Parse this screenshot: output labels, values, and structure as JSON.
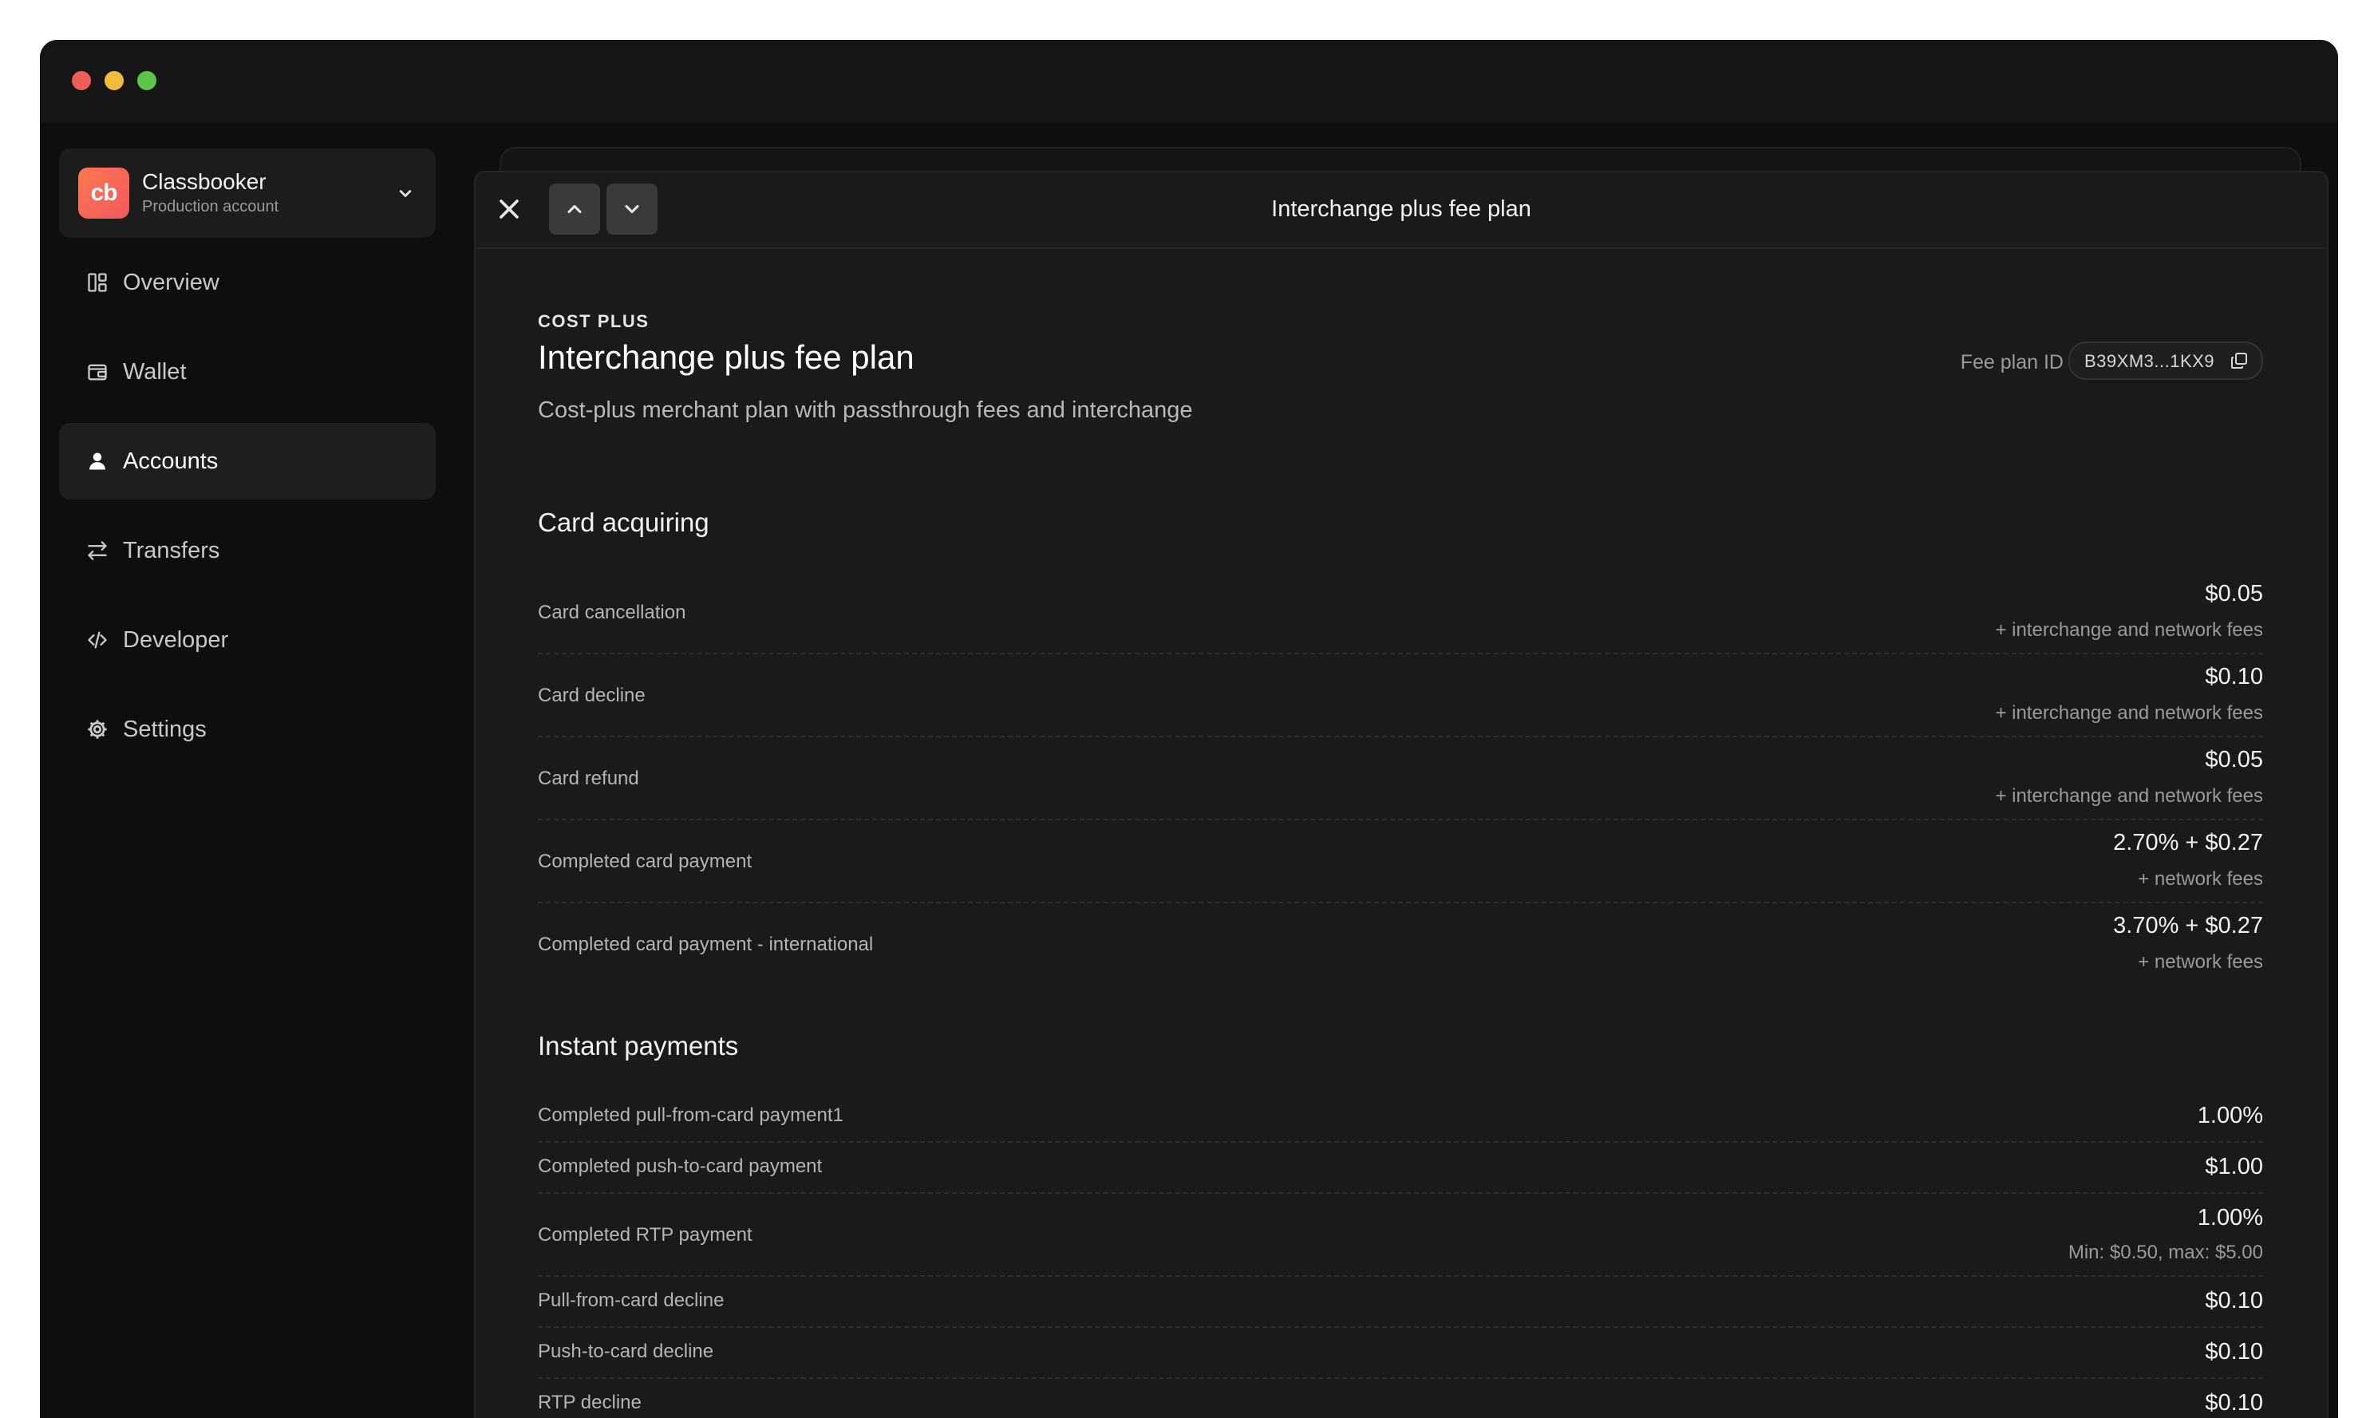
{
  "account": {
    "name": "Classbooker",
    "subtitle": "Production account",
    "logo_text": "cb"
  },
  "sidebar": {
    "items": [
      {
        "label": "Overview",
        "icon": "layout-grid-icon"
      },
      {
        "label": "Wallet",
        "icon": "wallet-icon"
      },
      {
        "label": "Accounts",
        "icon": "user-icon",
        "active": true
      },
      {
        "label": "Transfers",
        "icon": "transfer-arrows-icon"
      },
      {
        "label": "Developer",
        "icon": "code-icon"
      },
      {
        "label": "Settings",
        "icon": "gear-icon"
      }
    ]
  },
  "panel": {
    "header_title": "Interchange plus fee plan",
    "eyebrow": "COST PLUS",
    "title": "Interchange plus fee plan",
    "description": "Cost-plus merchant plan with passthrough fees and interchange",
    "fee_plan_id_label": "Fee plan ID",
    "fee_plan_id": "B39XM3...1KX9"
  },
  "sections": [
    {
      "title": "Card acquiring",
      "rows": [
        {
          "label": "Card cancellation",
          "value": "$0.05",
          "note": "+ interchange and network fees"
        },
        {
          "label": "Card decline",
          "value": "$0.10",
          "note": "+ interchange and network fees"
        },
        {
          "label": "Card refund",
          "value": "$0.05",
          "note": "+ interchange and network fees"
        },
        {
          "label": "Completed card payment",
          "value": "2.70% + $0.27",
          "note": "+ network fees"
        },
        {
          "label": "Completed card payment - international",
          "value": "3.70% + $0.27",
          "note": "+ network fees"
        }
      ]
    },
    {
      "title": "Instant payments",
      "rows": [
        {
          "label": "Completed pull-from-card payment1",
          "value": "1.00%"
        },
        {
          "label": "Completed push-to-card payment",
          "value": "$1.00"
        },
        {
          "label": "Completed RTP payment",
          "value": "1.00%",
          "note": "Min: $0.50, max: $5.00"
        },
        {
          "label": "Pull-from-card decline",
          "value": "$0.10"
        },
        {
          "label": "Push-to-card decline",
          "value": "$0.10"
        },
        {
          "label": "RTP decline",
          "value": "$0.10"
        }
      ]
    }
  ]
}
